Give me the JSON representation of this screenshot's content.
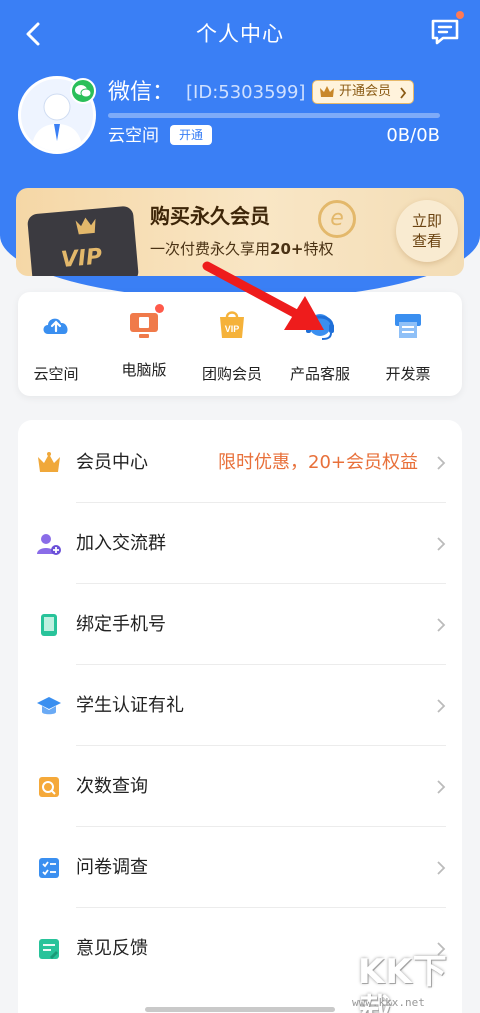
{
  "header": {
    "title": "个人中心",
    "user_name": "微信：",
    "user_id": "[ID:5303599]",
    "vip_button": "开通会员",
    "cloud_label": "云空间",
    "open_button": "开通",
    "storage": "0B/0B",
    "storage_used_fraction": 0
  },
  "vip_banner": {
    "title": "购买永久会员",
    "subtitle_prefix": "一次付费永久享用",
    "subtitle_bold": "20+",
    "subtitle_suffix": "特权",
    "card_text": "VIP",
    "logo_letter": "e",
    "view_button_line1": "立即",
    "view_button_line2": "查看"
  },
  "quick_actions": [
    {
      "label": "云空间",
      "icon": "cloud-upload-icon"
    },
    {
      "label": "电脑版",
      "icon": "desktop-icon"
    },
    {
      "label": "团购会员",
      "icon": "vip-bag-icon"
    },
    {
      "label": "产品客服",
      "icon": "headset-icon"
    },
    {
      "label": "开发票",
      "icon": "invoice-printer-icon"
    }
  ],
  "menu": [
    {
      "label": "会员中心",
      "promo": "限时优惠，20+会员权益",
      "icon": "crown-icon"
    },
    {
      "label": "加入交流群",
      "icon": "add-group-icon"
    },
    {
      "label": "绑定手机号",
      "icon": "phone-icon"
    },
    {
      "label": "学生认证有礼",
      "icon": "graduation-cap-icon"
    },
    {
      "label": "次数查询",
      "icon": "search-document-icon"
    },
    {
      "label": "问卷调查",
      "icon": "checklist-icon"
    },
    {
      "label": "意见反馈",
      "icon": "feedback-edit-icon"
    }
  ],
  "watermark": {
    "text": "KK下载",
    "url": "www.kkx.net"
  },
  "colors": {
    "primary": "#3a7ff5",
    "promo": "#e8703a",
    "gold": "#e3b86b"
  }
}
